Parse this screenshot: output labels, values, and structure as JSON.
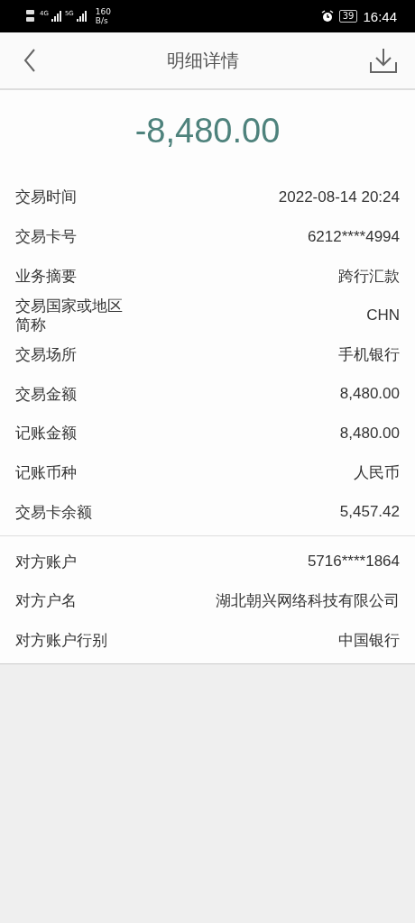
{
  "status_bar": {
    "network_1": "4G",
    "network_2": "5G",
    "speed_value": "160",
    "speed_unit": "B/s",
    "battery": "39",
    "time": "16:44"
  },
  "header": {
    "title": "明细详情"
  },
  "amount": "-8,480.00",
  "sections": [
    {
      "rows": [
        {
          "label": "交易时间",
          "value": "2022-08-14 20:24"
        },
        {
          "label": "交易卡号",
          "value": "6212****4994"
        },
        {
          "label": "业务摘要",
          "value": "跨行汇款"
        },
        {
          "label": "交易国家或地区简称",
          "value": "CHN"
        },
        {
          "label": "交易场所",
          "value": "手机银行"
        },
        {
          "label": "交易金额",
          "value": "8,480.00"
        },
        {
          "label": "记账金额",
          "value": "8,480.00"
        },
        {
          "label": "记账币种",
          "value": "人民币"
        },
        {
          "label": "交易卡余额",
          "value": "5,457.42"
        }
      ]
    },
    {
      "rows": [
        {
          "label": "对方账户",
          "value": "5716****1864"
        },
        {
          "label": "对方户名",
          "value": "湖北朝兴网络科技有限公司"
        },
        {
          "label": "对方账户行别",
          "value": "中国银行"
        }
      ]
    }
  ]
}
